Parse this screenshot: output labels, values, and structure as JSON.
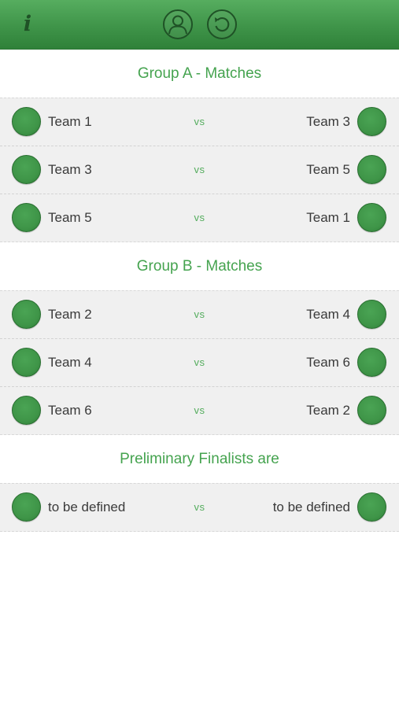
{
  "toolbar": {
    "info_label": "i",
    "icons": [
      "info-icon",
      "profile-icon",
      "reset-icon"
    ],
    "accent": "#3f9449"
  },
  "sections": [
    {
      "title": "Group A - Matches",
      "matches": [
        {
          "home": "Team 1",
          "vs": "vs",
          "away": "Team 3"
        },
        {
          "home": "Team 3",
          "vs": "vs",
          "away": "Team 5"
        },
        {
          "home": "Team 5",
          "vs": "vs",
          "away": "Team 1"
        }
      ]
    },
    {
      "title": "Group B - Matches",
      "matches": [
        {
          "home": "Team 2",
          "vs": "vs",
          "away": "Team 4"
        },
        {
          "home": "Team 4",
          "vs": "vs",
          "away": "Team 6"
        },
        {
          "home": "Team 6",
          "vs": "vs",
          "away": "Team 2"
        }
      ]
    },
    {
      "title": "Preliminary Finalists are",
      "matches": [
        {
          "home": "to be defined",
          "vs": "vs",
          "away": "to be defined"
        }
      ]
    }
  ]
}
